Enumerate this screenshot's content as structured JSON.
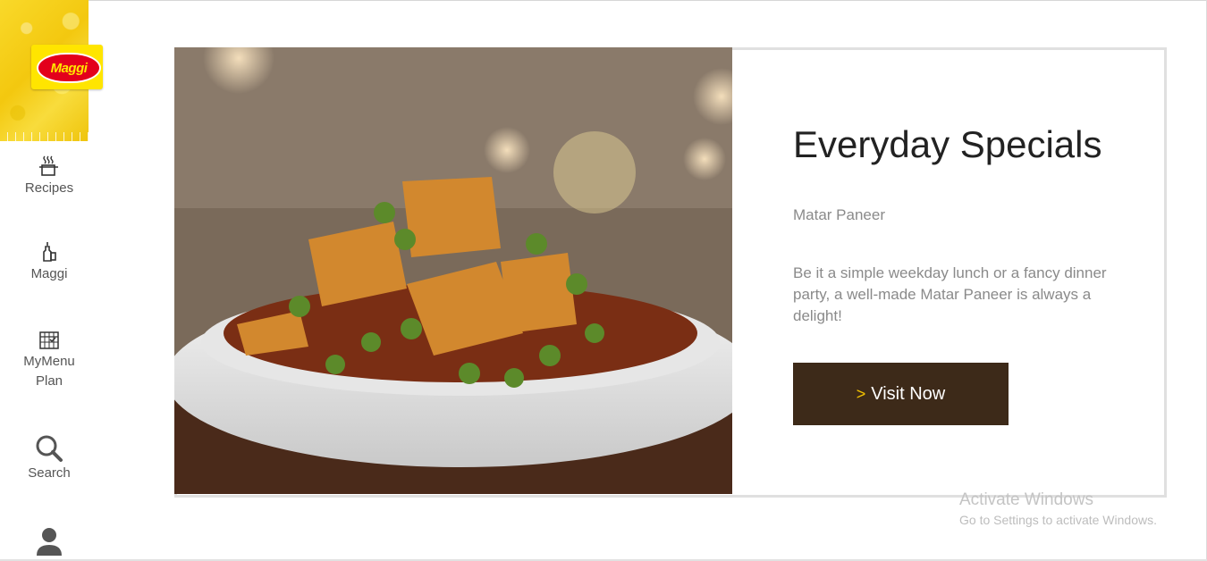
{
  "brand": {
    "logo_text": "Maggi",
    "yellow": "#f3c80f",
    "red": "#e3001b"
  },
  "sidebar": {
    "items": [
      {
        "label": "Recipes",
        "icon": "cooking-pot-icon"
      },
      {
        "label": "Maggi",
        "icon": "bottle-icon"
      },
      {
        "label_line1": "MyMenu",
        "label_line2": "Plan",
        "icon": "calendar-icon"
      },
      {
        "label": "Search",
        "icon": "search-icon"
      },
      {
        "label": "",
        "icon": "user-icon"
      }
    ]
  },
  "banner": {
    "title": "Everyday Specials",
    "subtitle": "Matar Paneer",
    "description": "Be it a simple weekday lunch or a fancy dinner party, a well-made Matar Paneer is always a delight!",
    "button_chevron": ">",
    "button_label": "Visit Now",
    "button_color": "#3d2a19",
    "image": "matar-paneer-dish-photo"
  },
  "os_watermark": {
    "line1": "Activate Windows",
    "line2": "Go to Settings to activate Windows."
  }
}
